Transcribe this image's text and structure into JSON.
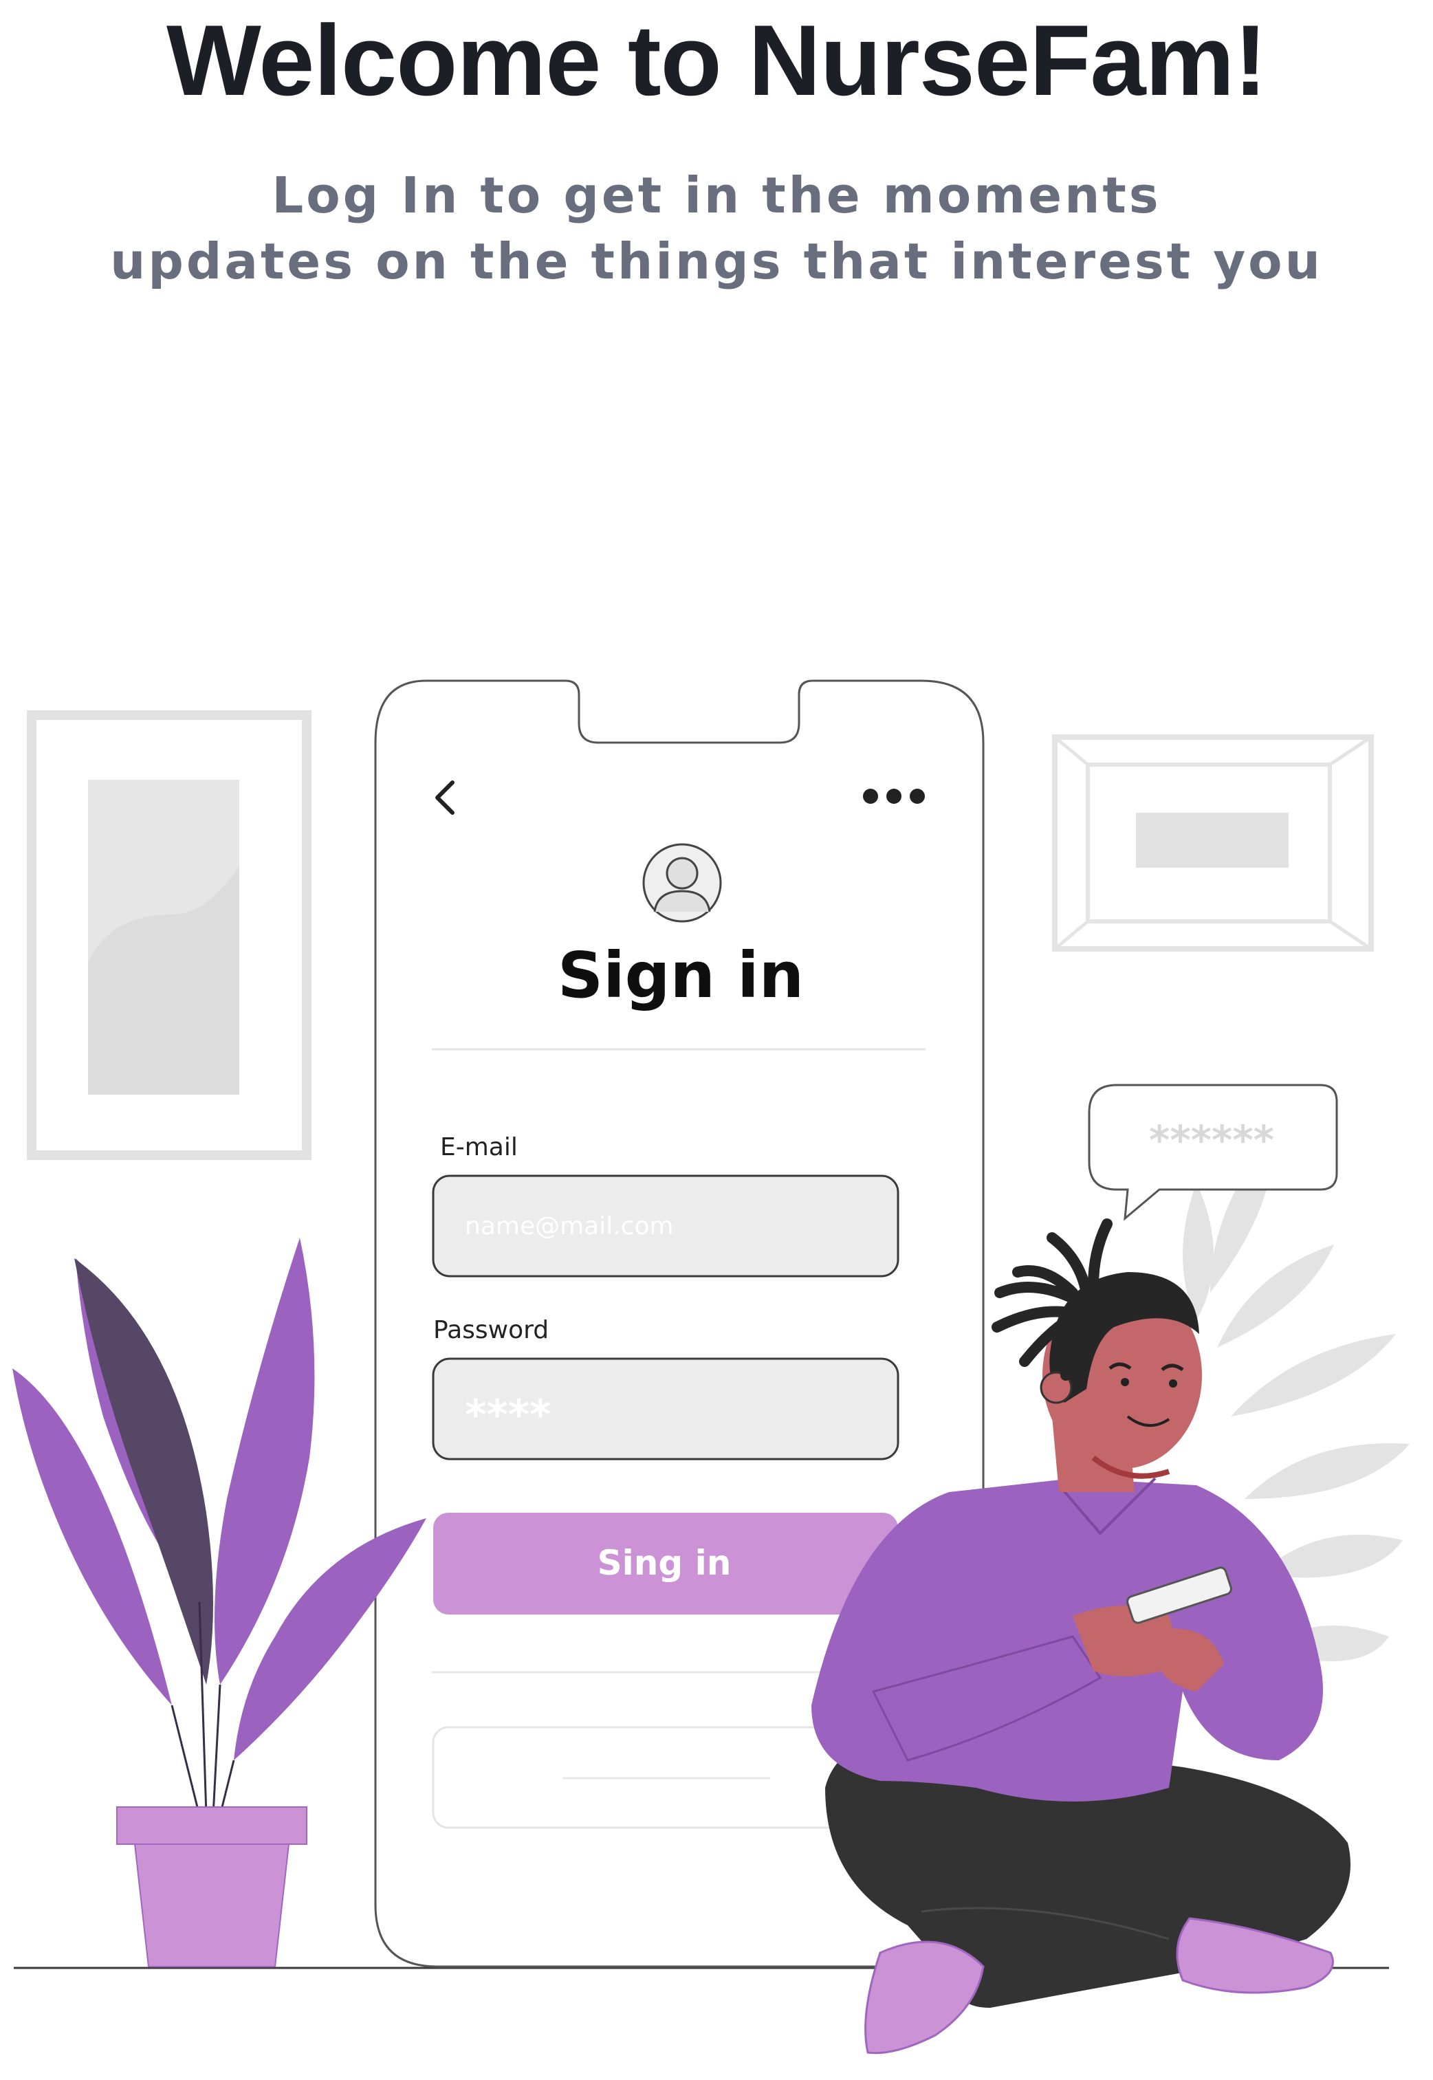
{
  "header": {
    "title": "Welcome to NurseFam!",
    "subtitle_line1": "Log In to get in the moments",
    "subtitle_line2": "updates on the things that interest you"
  },
  "phone": {
    "back_icon": "chevron-left-icon",
    "menu_icon": "more-dots-icon",
    "avatar_icon": "user-avatar-icon",
    "heading": "Sign in",
    "email_label": "E-mail",
    "email_placeholder": "name@mail.com",
    "password_label": "Password",
    "password_value": "****",
    "signin_button_label": "Sing in"
  },
  "speech_bubble": {
    "text": "******"
  },
  "colors": {
    "accent_purple": "#9b62bf",
    "light_purple": "#cc92d6",
    "dark_text": "#1d1f26",
    "subtitle_gray": "#686e7e"
  }
}
